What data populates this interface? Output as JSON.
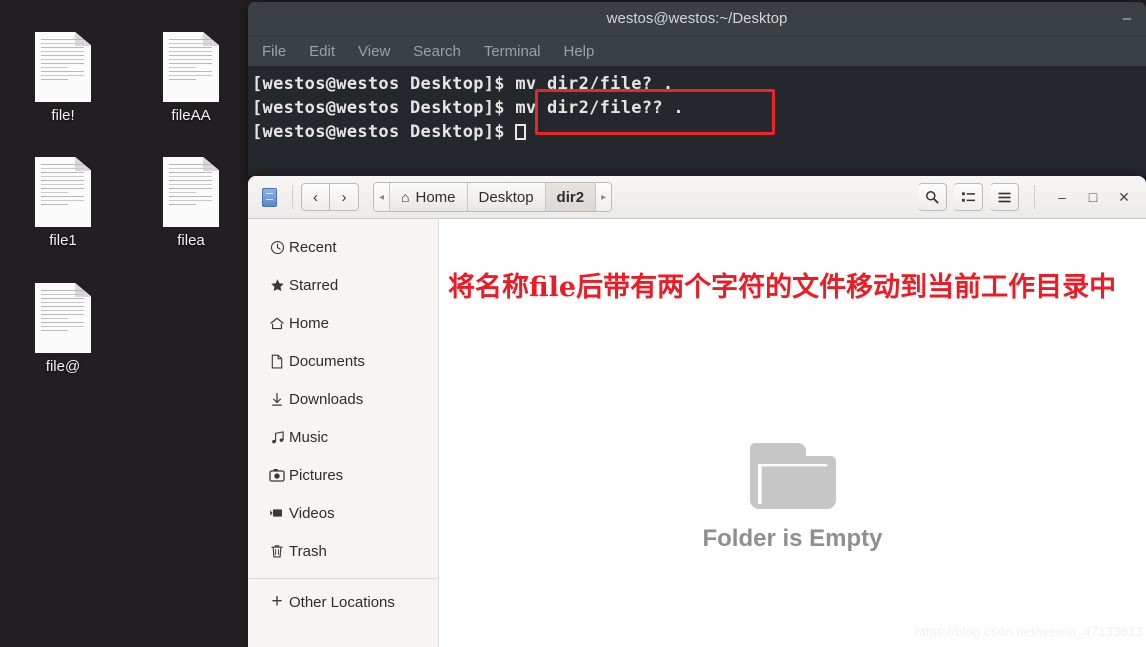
{
  "desktop": {
    "icons": [
      {
        "name": "file!",
        "icon": "document-icon"
      },
      {
        "name": "fileAA",
        "icon": "document-icon"
      },
      {
        "name": "file1",
        "icon": "document-icon"
      },
      {
        "name": "filea",
        "icon": "document-icon"
      },
      {
        "name": "file@",
        "icon": "document-icon"
      }
    ],
    "background_color": "#211f22"
  },
  "terminal": {
    "title": "westos@westos:~/Desktop",
    "minimize_label": "–",
    "menu": [
      "File",
      "Edit",
      "View",
      "Search",
      "Terminal",
      "Help"
    ],
    "lines": [
      "[westos@westos Desktop]$ mv dir2/file? .",
      "[westos@westos Desktop]$ mv dir2/file?? .",
      "[westos@westos Desktop]$ "
    ],
    "prompt": "[westos@westos Desktop]$ ",
    "highlighted_command": "mv dir2/file?? .",
    "highlight_color": "#e8252a",
    "background_color": "#24272b",
    "titlebar_color": "#3b4045"
  },
  "filemanager": {
    "drive_icon": "file-cabinet-icon",
    "nav": {
      "back": "‹",
      "forward": "›"
    },
    "breadcrumb": {
      "prev_arrow": "◂",
      "next_arrow": "▸",
      "items": [
        {
          "label": "Home",
          "icon": "home-icon",
          "active": false
        },
        {
          "label": "Desktop",
          "icon": "",
          "active": false
        },
        {
          "label": "dir2",
          "icon": "",
          "active": true
        }
      ]
    },
    "toolbar": {
      "search": "⚲",
      "view_list": "≣",
      "menu": "☰"
    },
    "window_controls": {
      "minimize": "–",
      "maximize": "□",
      "close": "✕"
    },
    "sidebar": [
      {
        "label": "Recent",
        "icon": "clock-icon",
        "glyph": "◴"
      },
      {
        "label": "Starred",
        "icon": "star-icon",
        "glyph": "★"
      },
      {
        "label": "Home",
        "icon": "home-icon",
        "glyph": "⌂"
      },
      {
        "label": "Documents",
        "icon": "document-icon",
        "glyph": "὜b"
      },
      {
        "label": "Downloads",
        "icon": "download-icon",
        "glyph": "↡"
      },
      {
        "label": "Music",
        "icon": "music-note-icon",
        "glyph": "♫"
      },
      {
        "label": "Pictures",
        "icon": "camera-icon",
        "glyph": "▣"
      },
      {
        "label": "Videos",
        "icon": "video-camera-icon",
        "glyph": "▶"
      },
      {
        "label": "Trash",
        "icon": "trash-icon",
        "glyph": "⌧"
      }
    ],
    "other_locations": {
      "label": "Other Locations",
      "icon": "plus-icon",
      "glyph": "+"
    },
    "annotation": {
      "text": "将名称file后带有两个字符的文件移动到当前工作目录中",
      "color": "#ee1b24"
    },
    "empty_state": {
      "label": "Folder is Empty",
      "icon": "folder-icon"
    },
    "watermark": "https://blog.csdn.net/weixin_47133613"
  }
}
